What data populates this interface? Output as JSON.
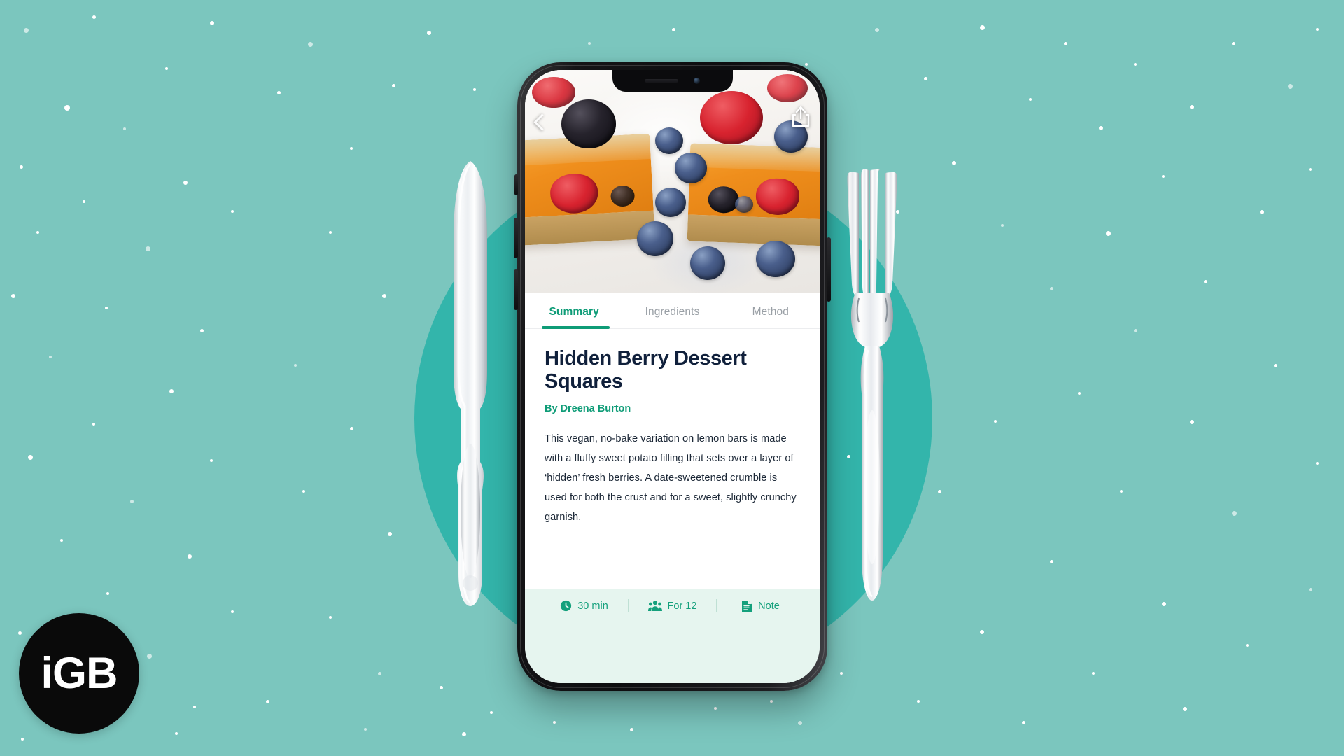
{
  "scene": {
    "background_color": "#7bc6be",
    "accent_circle_color": "#33b5ab",
    "brand_green": "#0e9c77",
    "title_navy": "#10203b",
    "meta_bar_color": "#e6f5ef"
  },
  "watermark": {
    "text": "iGB",
    "shape": "circle",
    "bg": "#0a0a0a",
    "fg": "#ffffff"
  },
  "decor": {
    "knife_label": "silver-dinner-knife",
    "fork_label": "silver-dinner-fork"
  },
  "phone": {
    "device": "smartphone-with-notch",
    "status": {
      "speaker": "earpiece-speaker",
      "camera": "front-camera"
    }
  },
  "app": {
    "hero": {
      "photo_alt": "Dessert squares topped with blackberry, raspberry and blueberries",
      "back_label": "Back",
      "share_label": "Share"
    },
    "tabs": [
      {
        "label": "Summary",
        "active": true
      },
      {
        "label": "Ingredients",
        "active": false
      },
      {
        "label": "Method",
        "active": false
      }
    ],
    "recipe": {
      "title": "Hidden Berry Dessert Squares",
      "byline": "By Dreena Burton",
      "description": "This vegan, no-bake variation on lemon bars is made with a fluffy sweet potato filling that sets over a layer of ‘hidden’ fresh berries. A date-sweetened crumble is used for both the crust and for a sweet, slightly crunchy garnish."
    },
    "meta": [
      {
        "icon": "clock-icon",
        "label": "30 min"
      },
      {
        "icon": "people-icon",
        "label": "For 12"
      },
      {
        "icon": "note-icon",
        "label": "Note"
      }
    ]
  }
}
